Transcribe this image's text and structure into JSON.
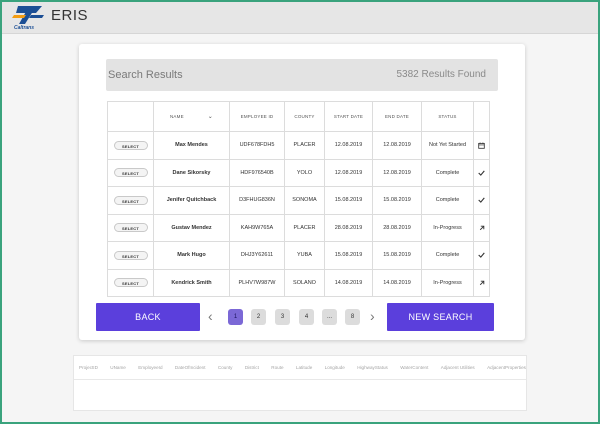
{
  "header": {
    "app_title": "ERIS",
    "logo_text": "Caltrans",
    "logo_icon": "caltrans-logo-icon"
  },
  "search": {
    "title": "Search Results",
    "count": "5382 Results Found"
  },
  "table": {
    "columns": [
      "",
      "NAME",
      "EMPLOYEE ID",
      "COUNTY",
      "START DATE",
      "END DATE",
      "STATUS",
      ""
    ],
    "select_label": "SELECT",
    "rows": [
      {
        "name": "Max Mendes",
        "employee_id": "UDF678FDH5",
        "county": "PLACER",
        "start_date": "12.08.2019",
        "end_date": "12.08.2019",
        "status": "Not Yet Started",
        "icon": "calendar-icon"
      },
      {
        "name": "Dane Sikorsky",
        "employee_id": "HDF976540B",
        "county": "YOLO",
        "start_date": "12.08.2019",
        "end_date": "12.08.2019",
        "status": "Complete",
        "icon": "check-icon"
      },
      {
        "name": "Jenifer Quitchback",
        "employee_id": "D3FHUG836N",
        "county": "SONOMA",
        "start_date": "15.08.2019",
        "end_date": "15.08.2019",
        "status": "Complete",
        "icon": "check-icon"
      },
      {
        "name": "Gustav Mendez",
        "employee_id": "KAH9W765A",
        "county": "PLACER",
        "start_date": "28.08.2019",
        "end_date": "28.08.2019",
        "status": "In-Progress",
        "icon": "arrow-up-right-icon"
      },
      {
        "name": "Mark Hugo",
        "employee_id": "DHJ3Y62611",
        "county": "YUBA",
        "start_date": "15.08.2019",
        "end_date": "15.08.2019",
        "status": "Complete",
        "icon": "check-icon"
      },
      {
        "name": "Kendrick Smith",
        "employee_id": "PLHV7W987W",
        "county": "SOLANO",
        "start_date": "14.08.2019",
        "end_date": "14.08.2019",
        "status": "In-Progress",
        "icon": "arrow-up-right-icon"
      }
    ]
  },
  "pagination": {
    "back_label": "BACK",
    "new_search_label": "NEW SEARCH",
    "pages": [
      "1",
      "2",
      "3",
      "4",
      "...",
      "8"
    ],
    "active_page": "1",
    "prev_glyph": "‹",
    "next_glyph": "›"
  },
  "secondary_table": {
    "columns": [
      "ProjectID",
      "UName",
      "EmployeeId",
      "DateOfIncident",
      "County",
      "District",
      "Route",
      "Latitude",
      "Longitude",
      "HighwayStatus",
      "WaterContent",
      "Adjacent Utilities",
      "AdjacentProperties"
    ]
  },
  "colors": {
    "accent": "#5b3fdc",
    "active_page": "#7b68d6",
    "frame": "#3aa37d",
    "logo_blue": "#1c4f95",
    "logo_orange": "#f39c12"
  }
}
